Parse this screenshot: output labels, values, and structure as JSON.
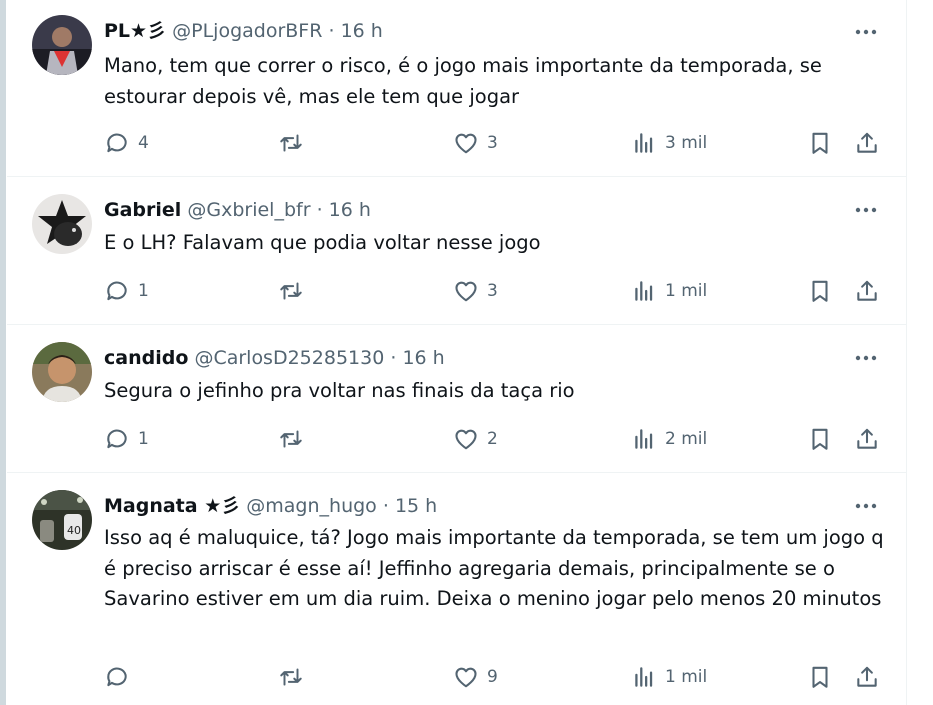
{
  "tweets": [
    {
      "name": "PL★彡",
      "handle": "@PLjogadorBFR",
      "time": "16 h",
      "text": "Mano, tem que correr o risco, é o jogo mais importante da temporada, se estourar depois vê, mas ele tem que jogar",
      "replies": "4",
      "retweets": "",
      "likes": "3",
      "views": "3 mil"
    },
    {
      "name": "Gabriel",
      "handle": "@Gxbriel_bfr",
      "time": "16 h",
      "text": "E o LH? Falavam que podia voltar nesse jogo",
      "replies": "1",
      "retweets": "",
      "likes": "3",
      "views": "1 mil"
    },
    {
      "name": "candido",
      "handle": "@CarlosD25285130",
      "time": "16 h",
      "text": "Segura o jefinho pra voltar nas finais da taça rio",
      "replies": "1",
      "retweets": "",
      "likes": "2",
      "views": "2 mil"
    },
    {
      "name": "Magnata ★彡",
      "handle": "@magn_hugo",
      "time": "15 h",
      "text": "Isso aq é maluquice, tá? Jogo mais importante da temporada, se tem um jogo q é preciso arriscar é esse aí! Jeffinho agregaria demais, principalmente se o Savarino estiver em um dia ruim. Deixa o menino jogar pelo menos 20 minutos",
      "replies": "",
      "retweets": "",
      "likes": "9",
      "views": "1 mil"
    }
  ],
  "colors": {
    "text": "#0f1419",
    "muted": "#536471",
    "divider": "#eff3f4",
    "rail": "#cfd9de"
  },
  "icons": [
    "more-icon",
    "reply-icon",
    "retweet-icon",
    "like-icon",
    "views-icon",
    "bookmark-icon",
    "share-icon"
  ]
}
